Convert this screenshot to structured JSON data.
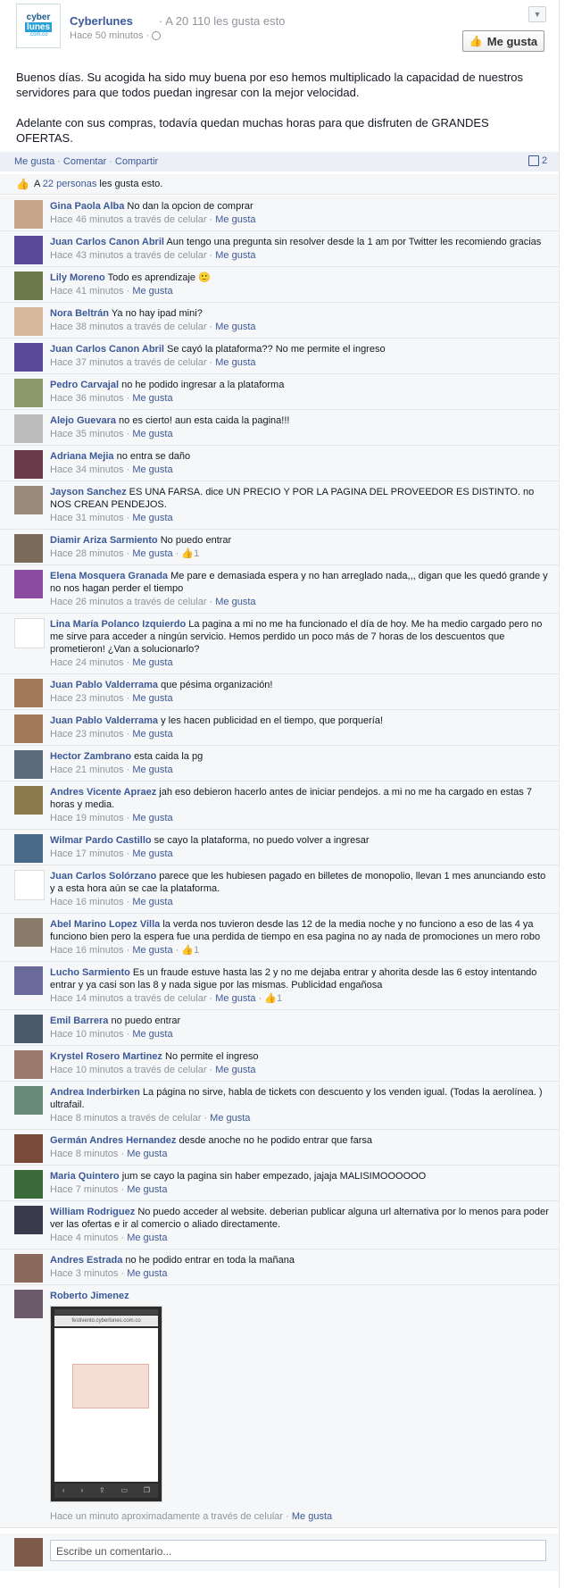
{
  "page": {
    "logo_text": [
      "cyber",
      "lunes",
      ".com.co"
    ],
    "name": "Cyberlunes",
    "likes_text": "· A 20 110 les gusta esto",
    "time": "Hace 50 minutos ·",
    "like_button": "Me gusta"
  },
  "post": {
    "paragraphs": [
      "Buenos días. Su acogida ha sido muy buena por eso hemos multiplicado la capacidad de nuestros servidores para que todos puedan ingresar con la mejor velocidad.",
      "Adelante con sus compras, todavía quedan muchas horas para que disfruten de GRANDES OFERTAS."
    ]
  },
  "actions": {
    "like": "Me gusta",
    "comment": "Comentar",
    "share": "Compartir",
    "comment_count": "2"
  },
  "likes_line": {
    "prefix": "A",
    "link": "22 personas",
    "suffix": "les gusta esto."
  },
  "comments": [
    {
      "name": "Gina Paola Alba",
      "text": "No dan la opcion de comprar",
      "time": "Hace 46 minutos a través de celular",
      "like": "Me gusta",
      "likes": "",
      "color": "#c7a58a"
    },
    {
      "name": "Juan Carlos Canon Abril",
      "text": "Aun tengo una pregunta sin resolver desde la 1 am por Twitter les recomiendo gracias",
      "time": "Hace 43 minutos a través de celular",
      "like": "Me gusta",
      "likes": "",
      "color": "#5a4a9a"
    },
    {
      "name": "Lily Moreno",
      "text": "Todo es aprendizaje 🙂",
      "time": "Hace 41 minutos",
      "like": "Me gusta",
      "likes": "",
      "color": "#6b7a4a"
    },
    {
      "name": "Nora Beltrán",
      "text": "Ya no hay ipad mini?",
      "time": "Hace 38 minutos a través de celular",
      "like": "Me gusta",
      "likes": "",
      "color": "#d8b89a"
    },
    {
      "name": "Juan Carlos Canon Abril",
      "text": "Se cayó la plataforma?? No me permite el ingreso",
      "time": "Hace 37 minutos a través de celular",
      "like": "Me gusta",
      "likes": "",
      "color": "#5a4a9a"
    },
    {
      "name": "Pedro Carvajal",
      "text": "no he podido ingresar a la plataforma",
      "time": "Hace 36 minutos",
      "like": "Me gusta",
      "likes": "",
      "color": "#8a9a6a"
    },
    {
      "name": "Alejo Guevara",
      "text": "no es cierto! aun esta caida la pagina!!!",
      "time": "Hace 35 minutos",
      "like": "Me gusta",
      "likes": "",
      "color": "#bcbcbc"
    },
    {
      "name": "Adriana Mejia",
      "text": "no entra se daño",
      "time": "Hace 34 minutos",
      "like": "Me gusta",
      "likes": "",
      "color": "#6a3a4a"
    },
    {
      "name": "Jayson Sanchez",
      "text": "ES UNA FARSA. dice UN PRECIO Y POR LA PAGINA DEL PROVEEDOR ES DISTINTO. no NOS CREAN PENDEJOS.",
      "time": "Hace 31 minutos",
      "like": "Me gusta",
      "likes": "",
      "color": "#9a8a7a"
    },
    {
      "name": "Diamir Ariza Sarmiento",
      "text": "No puedo entrar",
      "time": "Hace 28 minutos",
      "like": "Me gusta",
      "likes": "1",
      "color": "#7a6a5a"
    },
    {
      "name": "Elena Mosquera Granada",
      "text": "Me pare e demasiada espera y no han arreglado nada,,, digan que les quedó grande y no nos hagan perder el tiempo",
      "time": "Hace 26 minutos a través de celular",
      "like": "Me gusta",
      "likes": "",
      "color": "#8a4aa0"
    },
    {
      "name": "Lina María Polanco Izquierdo",
      "text": "La pagina a mi no me ha funcionado el día de hoy. Me ha medio cargado pero no me sirve para acceder a ningún servicio. Hemos perdido un poco más de 7 horas de los descuentos que prometieron! ¿Van a solucionarlo?",
      "time": "Hace 24 minutos",
      "like": "Me gusta",
      "likes": "",
      "color": "#ffffff"
    },
    {
      "name": "Juan Pablo Valderrama",
      "text": "que pésima organización!",
      "time": "Hace 23 minutos",
      "like": "Me gusta",
      "likes": "",
      "color": "#a07a5a"
    },
    {
      "name": "Juan Pablo Valderrama",
      "text": "y les hacen publicidad en el tiempo, que porquería!",
      "time": "Hace 23 minutos",
      "like": "Me gusta",
      "likes": "",
      "color": "#a07a5a"
    },
    {
      "name": "Hector Zambrano",
      "text": "esta caida la pg",
      "time": "Hace 21 minutos",
      "like": "Me gusta",
      "likes": "",
      "color": "#5a6a7a"
    },
    {
      "name": "Andres Vicente Apraez",
      "text": "jah eso debieron hacerlo antes de iniciar pendejos. a mi no me ha cargado en estas 7 horas y media.",
      "time": "Hace 19 minutos",
      "like": "Me gusta",
      "likes": "",
      "color": "#8a7a4a"
    },
    {
      "name": "Wilmar Pardo Castillo",
      "text": "se cayo la plataforma, no puedo volver a ingresar",
      "time": "Hace 17 minutos",
      "like": "Me gusta",
      "likes": "",
      "color": "#4a6a8a"
    },
    {
      "name": "Juan Carlos Solórzano",
      "text": "parece que les hubiesen pagado en billetes de monopolio, llevan 1 mes anunciando esto y a esta hora aún se cae la plataforma.",
      "time": "Hace 16 minutos",
      "like": "Me gusta",
      "likes": "",
      "color": "#ffffff"
    },
    {
      "name": "Abel Marino Lopez Villa",
      "text": "la verda nos tuvieron desde las 12 de la media noche y no funciono a eso de las 4 ya funciono bien pero la espera fue una perdida de tiempo en esa pagina no ay nada de promociones un mero robo",
      "time": "Hace 16 minutos",
      "like": "Me gusta",
      "likes": "1",
      "color": "#8a7a6a"
    },
    {
      "name": "Lucho Sarmiento",
      "text": "Es un fraude estuve hasta las 2 y no me dejaba entrar y ahorita desde las 6 estoy intentando entrar y ya casi son las 8 y nada sigue por las mismas. Publicidad engañosa",
      "time": "Hace 14 minutos a través de celular",
      "like": "Me gusta",
      "likes": "1",
      "color": "#6a6a9a"
    },
    {
      "name": "Emil Barrera",
      "text": "no puedo entrar",
      "time": "Hace 10 minutos",
      "like": "Me gusta",
      "likes": "",
      "color": "#4a5a6a"
    },
    {
      "name": "Krystel Rosero Martinez",
      "text": "No permite el ingreso",
      "time": "Hace 10 minutos a través de celular",
      "like": "Me gusta",
      "likes": "",
      "color": "#9a7a6a"
    },
    {
      "name": "Andrea Inderbirken",
      "text": "La página no sirve, habla de tickets con descuento y los venden igual. (Todas la aerolínea. ) ultrafail.",
      "time": "Hace 8 minutos a través de celular",
      "like": "Me gusta",
      "likes": "",
      "color": "#6a8a7a"
    },
    {
      "name": "Germán Andres Hernandez",
      "text": "desde anoche no he podido entrar que farsa",
      "time": "Hace 8 minutos",
      "like": "Me gusta",
      "likes": "",
      "color": "#7a4a3a"
    },
    {
      "name": "Maria Quintero",
      "text": "jum se cayo la pagina sin haber empezado, jajaja MALISIMOOOOOO",
      "time": "Hace 7 minutos",
      "like": "Me gusta",
      "likes": "",
      "color": "#3a6a3a"
    },
    {
      "name": "William Rodriguez",
      "text": "No puedo acceder al website. deberian publicar alguna url alternativa por lo menos para poder ver las ofertas e ir al comercio o aliado directamente.",
      "time": "Hace 4 minutos",
      "like": "Me gusta",
      "likes": "",
      "color": "#3a3a4a"
    },
    {
      "name": "Andres Estrada",
      "text": "no he podido entrar en toda la mañana",
      "time": "Hace 3 minutos",
      "like": "Me gusta",
      "likes": "",
      "color": "#8a6a5a"
    }
  ],
  "last_comment": {
    "name": "Roberto Jimenez",
    "screenshot_url": "festivento.cyberlunes.com.co",
    "time": "Hace un minuto aproximadamente a través de celular",
    "like": "Me gusta",
    "color": "#6a5a6a"
  },
  "composer": {
    "placeholder": "Escribe un comentario..."
  }
}
